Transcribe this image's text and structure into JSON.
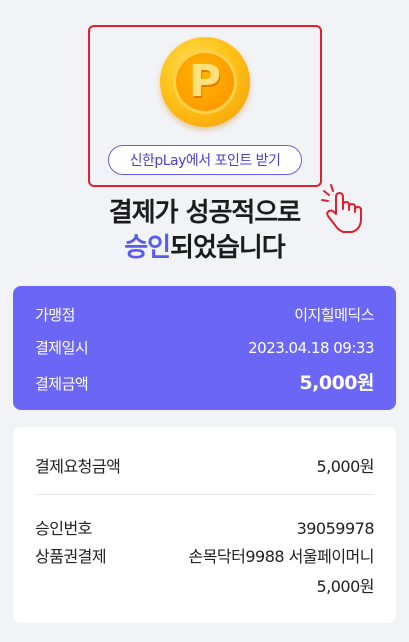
{
  "promo": {
    "coin_letter": "P",
    "button_label": "신한pLay에서 포인트 받기"
  },
  "headline": {
    "line1": "결제가 성공적으로",
    "line2_accent": "승인",
    "line2_rest": "되었습니다"
  },
  "summary": {
    "merchant_label": "가맹점",
    "merchant_value": "이지힐메딕스",
    "datetime_label": "결제일시",
    "datetime_value": "2023.04.18 09:33",
    "amount_label": "결제금액",
    "amount_value": "5,000원"
  },
  "details": {
    "requested_label": "결제요청금액",
    "requested_value": "5,000원",
    "approval_label": "승인번호",
    "approval_value": "39059978",
    "voucher_label": "상품권결제",
    "voucher_name": "손목닥터9988 서울페이머니",
    "voucher_amount": "5,000원"
  },
  "colors": {
    "accent": "#6b66f5",
    "highlight_border": "#e0202a",
    "coin": "#ffb300"
  },
  "icons": [
    "coin-p-icon",
    "tap-hand-icon"
  ]
}
